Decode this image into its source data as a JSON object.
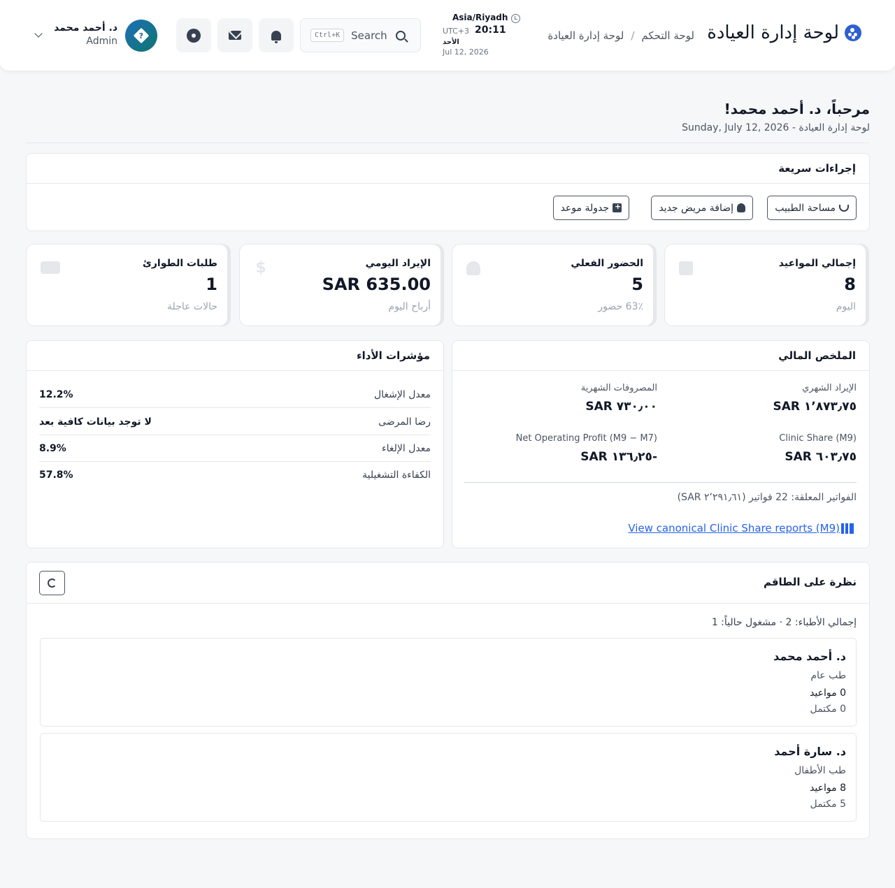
{
  "header": {
    "brand_title": "لوحة إدارة العيادة",
    "breadcrumb": [
      "لوحة التحكم",
      "لوحة إدارة العيادة"
    ],
    "breadcrumb_sep": "/",
    "timezone": "Asia/Riyadh",
    "utc_offset": "UTC+3",
    "time": "20:11",
    "day": "الأحد",
    "date": "Jul 12, 2026",
    "search_label": "Search",
    "search_shortcut": "Ctrl+K",
    "user_name": "د. أحمد محمد",
    "user_role": "Admin",
    "avatar_glyph": "?"
  },
  "welcome": {
    "title": "مرحباً، د. أحمد محمد!",
    "subtitle": "لوحة إدارة العيادة - Sunday, July 12, 2026"
  },
  "quick_actions": {
    "title": "إجراءات سريعة",
    "buttons": [
      "مساحة الطبيب",
      "إضافة مريض جديد",
      "جدولة موعد"
    ]
  },
  "stats": [
    {
      "label": "إجمالي المواعيد",
      "value": "8",
      "sub": "اليوم"
    },
    {
      "label": "الحضور الفعلي",
      "value": "5",
      "sub": "63٪ حضور"
    },
    {
      "label": "الإيراد اليومي",
      "value": "SAR 635.00",
      "sub": "أرباح اليوم"
    },
    {
      "label": "طلبات الطوارئ",
      "value": "1",
      "sub": "حالات عاجلة"
    }
  ],
  "financial": {
    "title": "الملخص المالي",
    "monthly_revenue_label": "الإيراد الشهري",
    "monthly_revenue_value": "١٬٨٧٣٫٧٥ SAR",
    "monthly_expenses_label": "المصروفات الشهرية",
    "monthly_expenses_value": "٧٣٠٫٠٠ SAR",
    "clinic_share_label": "Clinic Share (M9)",
    "clinic_share_value": "٦٠٣٫٧٥ SAR",
    "net_profit_label": "Net Operating Profit (M9 − M7)",
    "net_profit_value": "-١٣٦٫٢٥ SAR",
    "pending": "الفواتير المعلقة: 22 فواتير (٢٬٢٩١٫٦١ SAR)",
    "link": "View canonical Clinic Share reports (M9)"
  },
  "performance": {
    "title": "مؤشرات الأداء",
    "rows": [
      {
        "label": "معدل الإشغال",
        "value": "12.2%"
      },
      {
        "label": "رضا المرضى",
        "value": "لا توجد بيانات كافية بعد"
      },
      {
        "label": "معدل الإلغاء",
        "value": "8.9%"
      },
      {
        "label": "الكفاءة التشغيلية",
        "value": "57.8%"
      }
    ]
  },
  "staff": {
    "title": "نظرة على الطاقم",
    "summary": "إجمالي الأطباء: 2 · مشغول حالياً: 1",
    "doctors": [
      {
        "name": "د. أحمد محمد",
        "specialty": "طب عام",
        "appointments": "0 مواعيد",
        "completed": "0 مكتمل"
      },
      {
        "name": "د. سارة أحمد",
        "specialty": "طب الأطفال",
        "appointments": "8 مواعيد",
        "completed": "5 مكتمل"
      }
    ]
  }
}
